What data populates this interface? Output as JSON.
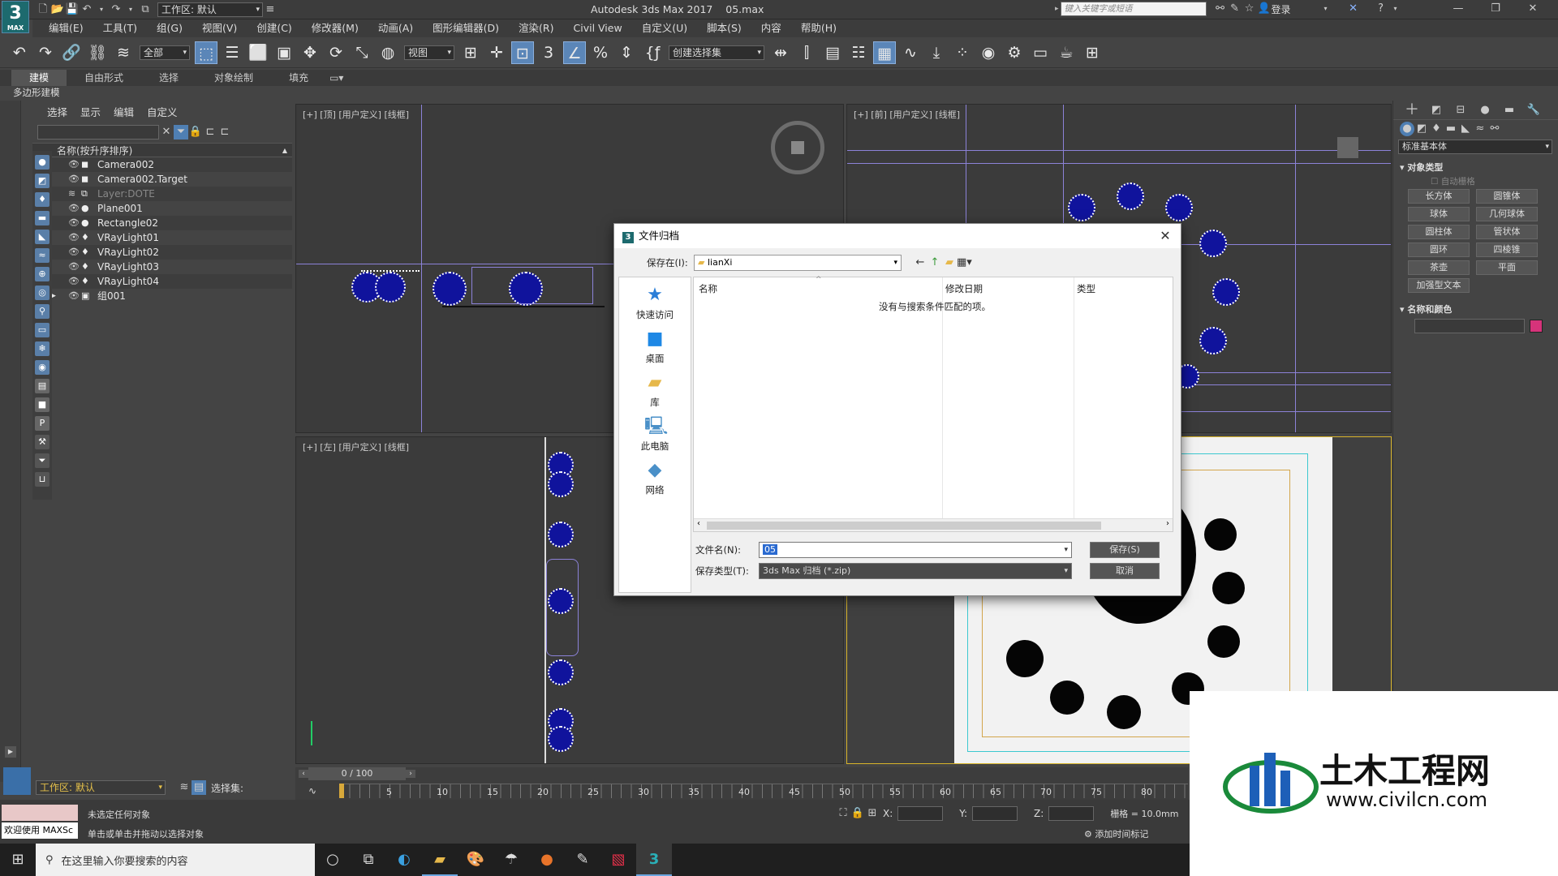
{
  "window": {
    "title": "Autodesk 3ds Max 2017",
    "file": "05.max",
    "search_placeholder": "键入关键字或短语",
    "login": "登录",
    "workspace": "工作区: 默认"
  },
  "app_logo": {
    "num": "3",
    "sub": "MAX"
  },
  "menu": [
    "编辑(E)",
    "工具(T)",
    "组(G)",
    "视图(V)",
    "创建(C)",
    "修改器(M)",
    "动画(A)",
    "图形编辑器(D)",
    "渲染(R)",
    "Civil View",
    "自定义(U)",
    "脚本(S)",
    "内容",
    "帮助(H)"
  ],
  "toolbar": {
    "filter": "全部",
    "view": "视图",
    "selset": "创建选择集"
  },
  "ribbon": {
    "tabs": [
      "建模",
      "自由形式",
      "选择",
      "对象绘制",
      "填充"
    ],
    "sub": "多边形建模"
  },
  "scene": {
    "tabs": [
      "选择",
      "显示",
      "编辑",
      "自定义"
    ],
    "header": "名称(按升序排序)",
    "items": [
      {
        "name": "Camera002",
        "type": "cam",
        "dim": false
      },
      {
        "name": "Camera002.Target",
        "type": "cam",
        "dim": false
      },
      {
        "name": "Layer:DOTE",
        "type": "layer",
        "dim": true
      },
      {
        "name": "Plane001",
        "type": "geo",
        "dim": false
      },
      {
        "name": "Rectangle02",
        "type": "geo",
        "dim": false
      },
      {
        "name": "VRayLight01",
        "type": "light",
        "dim": false
      },
      {
        "name": "VRayLight02",
        "type": "light",
        "dim": false
      },
      {
        "name": "VRayLight03",
        "type": "light",
        "dim": false
      },
      {
        "name": "VRayLight04",
        "type": "light",
        "dim": false
      },
      {
        "name": "组001",
        "type": "group",
        "dim": false
      }
    ],
    "workspace": "工作区: 默认",
    "selset_label": "选择集:"
  },
  "viewports": {
    "top": "[+] [顶] [用户定义] [线框]",
    "front": "[+] [前] [用户定义] [线框]",
    "left": "[+] [左] [用户定义] [线框]"
  },
  "command": {
    "dropdown": "标准基本体",
    "rollout1": "对象类型",
    "autogrid": "自动栅格",
    "buttons": [
      "长方体",
      "圆锥体",
      "球体",
      "几何球体",
      "圆柱体",
      "管状体",
      "圆环",
      "四棱锥",
      "茶壶",
      "平面",
      "加强型文本"
    ],
    "rollout2": "名称和颜色",
    "color": "#d6337a"
  },
  "dialog": {
    "title": "文件归档",
    "save_in_label": "保存在(I):",
    "folder": "lianXi",
    "places": [
      "快速访问",
      "桌面",
      "库",
      "此电脑",
      "网络"
    ],
    "cols": [
      "名称",
      "修改日期",
      "类型"
    ],
    "empty": "没有与搜索条件匹配的项。",
    "filename_label": "文件名(N):",
    "filename": "05",
    "filetype_label": "保存类型(T):",
    "filetype": "3ds Max 归档 (*.zip)",
    "save_btn": "保存(S)",
    "cancel_btn": "取消"
  },
  "timeline": {
    "frame": "0 / 100",
    "ticks": [
      "5",
      "10",
      "15",
      "20",
      "25",
      "30",
      "35",
      "40",
      "45",
      "50",
      "55",
      "60",
      "65",
      "70",
      "75",
      "80"
    ]
  },
  "status": {
    "line1": "未选定任何对象",
    "line2": "单击或单击并拖动以选择对象",
    "welcome": "欢迎使用 MAXSc",
    "x": "X:",
    "y": "Y:",
    "z": "Z:",
    "grid": "栅格 = 10.0mm",
    "addtime": "添加时间标记"
  },
  "taskbar": {
    "search": "在这里输入你要搜索的内容"
  },
  "watermark": {
    "cn": "土木工程网",
    "url": "www.civilcn.com"
  }
}
